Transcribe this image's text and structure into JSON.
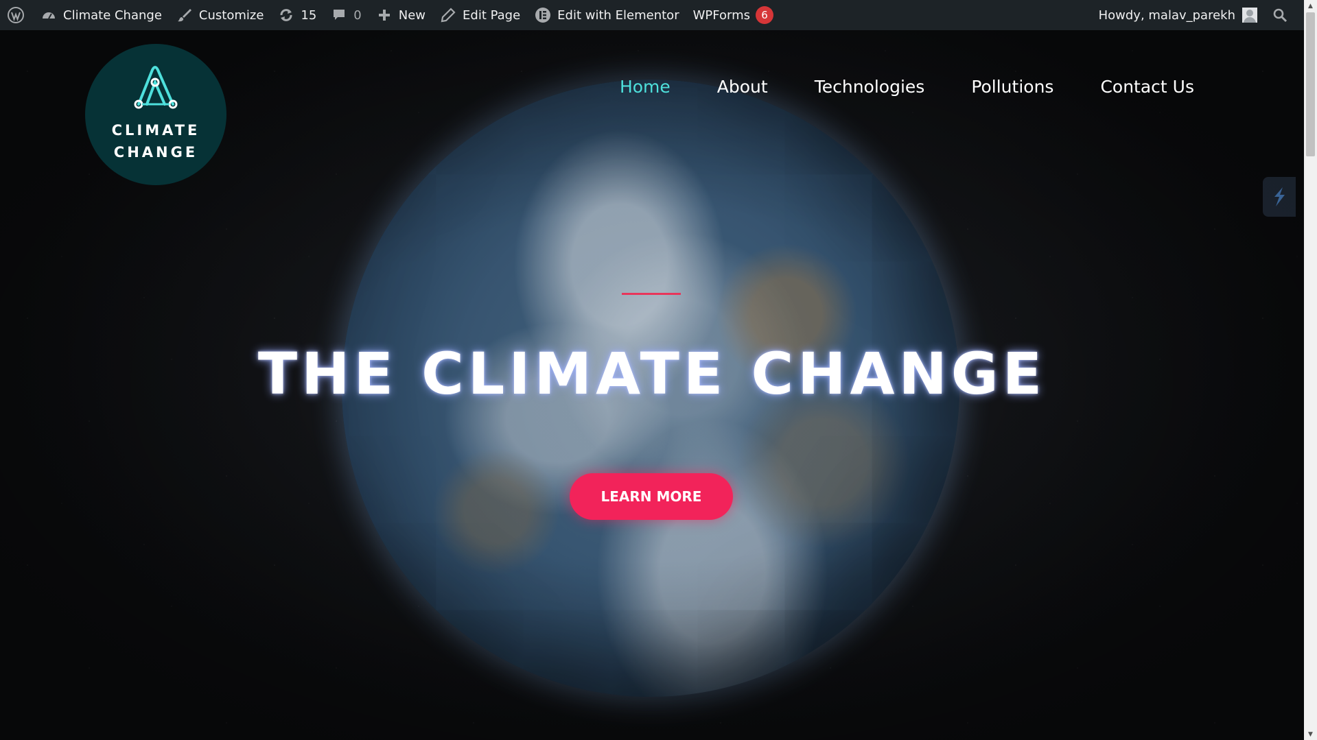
{
  "adminbar": {
    "site_name": "Climate Change",
    "customize": "Customize",
    "updates_count": "15",
    "comments_count": "0",
    "new": "New",
    "edit_page": "Edit Page",
    "edit_elementor": "Edit with Elementor",
    "wpforms": "WPForms",
    "wpforms_badge": "6",
    "howdy": "Howdy, malav_parekh"
  },
  "logo": {
    "line1": "CLIMATE",
    "line2": "CHANGE"
  },
  "nav": {
    "items": [
      {
        "label": "Home",
        "active": true
      },
      {
        "label": "About",
        "active": false
      },
      {
        "label": "Technologies",
        "active": false
      },
      {
        "label": "Pollutions",
        "active": false
      },
      {
        "label": "Contact Us",
        "active": false
      }
    ]
  },
  "hero": {
    "title": "THE CLIMATE CHANGE",
    "button": "LEARN MORE"
  },
  "colors": {
    "admin_bar": "#1d2327",
    "nav_active": "#4ee0dc",
    "logo_bg": "#063236",
    "accent": "#f2235a"
  },
  "icons": [
    "wordpress-icon",
    "dashboard-icon",
    "brush-icon",
    "updates-icon",
    "comment-icon",
    "plus-icon",
    "pencil-icon",
    "elementor-icon",
    "search-icon",
    "logo-mark-icon",
    "tool-icon"
  ]
}
